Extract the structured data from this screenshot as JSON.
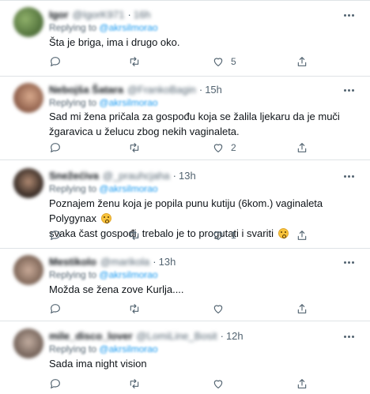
{
  "tweets": [
    {
      "name": "Igor",
      "handle": "@IgorK971",
      "time": "16h",
      "replying_prefix": "Replying to",
      "replying_handle": "@akrsilmorao",
      "text": "Šta je briga, ima i drugo oko.",
      "text_emoji": false,
      "retweets": "",
      "likes": "5",
      "avatar_color": "#6a8a4a"
    },
    {
      "name": "Nebojša Šatara",
      "handle": "@FrankoBagin",
      "time": "15h",
      "replying_prefix": "Replying to",
      "replying_handle": "@akrsilmorao",
      "text": "Sad mi žena pričala za gospođu koja se žalila ljekaru da je muči žgaravica u želucu zbog nekih vaginaleta.",
      "text_emoji": false,
      "retweets": "",
      "likes": "2",
      "avatar_color": "#b27a5e"
    },
    {
      "name": "Snežećiva",
      "handle": "@_prauhcjaha",
      "time": "13h",
      "replying_prefix": "Replying to",
      "replying_handle": "@akrsilmorao",
      "text": "Poznajem ženu koja je popila punu kutiju (6kom.) vaginaleta Polygynax",
      "text2": "svaka čast gospođi, trebalo je to progutati i svariti",
      "text_emoji": true,
      "retweets": "",
      "likes": "1",
      "avatar_color": "#4a3d35"
    },
    {
      "name": "Mestikolo",
      "handle": "@marikola",
      "time": "13h",
      "replying_prefix": "Replying to",
      "replying_handle": "@akrsilmorao",
      "text": "Možda se žena zove Kurlja....",
      "text_emoji": false,
      "retweets": "",
      "likes": "",
      "avatar_color": "#a88a7a"
    },
    {
      "name": "mile_disco_lover",
      "handle": "@LomiLine_Bosit",
      "time": "12h",
      "replying_prefix": "Replying to",
      "replying_handle": "@akrsilmorao",
      "text": "Sada ima night vision",
      "text_emoji": false,
      "retweets": "",
      "likes": "",
      "avatar_color": "#8f7e74"
    }
  ]
}
